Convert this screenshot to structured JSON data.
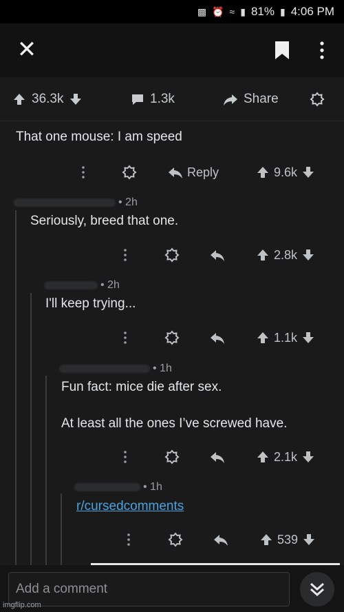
{
  "status_bar": {
    "battery": "81%",
    "time": "4:06 PM"
  },
  "post": {
    "upvotes": "36.3k",
    "comments": "1.3k",
    "share_label": "Share",
    "top_comment": "That one mouse: I am speed",
    "reply_label": "Reply",
    "top_comment_votes": "9.6k"
  },
  "comments": [
    {
      "meta": "• 2h",
      "text": "Seriously, breed that one.",
      "votes": "2.8k"
    },
    {
      "meta": "• 2h",
      "text": "I'll keep trying...",
      "votes": "1.1k"
    },
    {
      "meta": "• 1h",
      "text_line1": "Fun fact: mice die after sex.",
      "text_line2": "At least all the ones I’ve screwed have.",
      "votes": "2.1k"
    },
    {
      "meta": "• 1h",
      "link": "r/cursedcomments",
      "votes": "539"
    }
  ],
  "composer": {
    "placeholder": "Add a comment"
  },
  "watermark": "imgflip.com",
  "icons": [
    "close-icon",
    "bookmark-icon",
    "more-icon",
    "upvote-icon",
    "downvote-icon",
    "comment-icon",
    "share-icon",
    "award-icon",
    "reply-icon",
    "double-chevron-down-icon"
  ]
}
